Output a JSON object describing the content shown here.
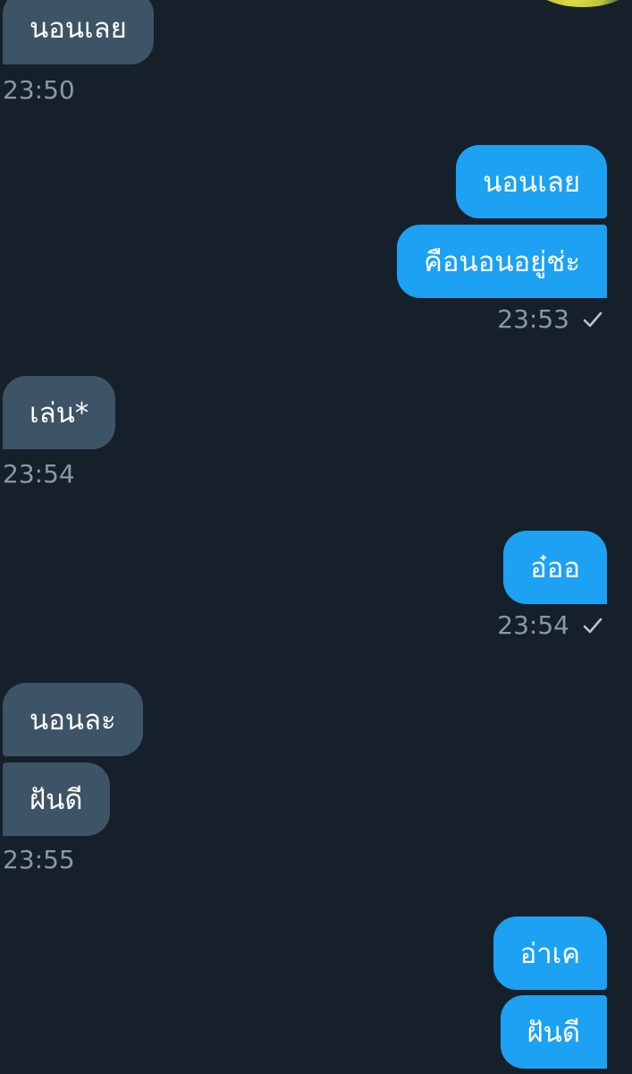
{
  "messages": [
    {
      "text": "นอนเลย",
      "dir": "in"
    },
    {
      "time": "23:50"
    },
    {
      "text": "นอนเลย",
      "dir": "out"
    },
    {
      "text": "คือนอนอยู่ช่ะ",
      "dir": "out"
    },
    {
      "time": "23:53"
    },
    {
      "text": "เล่น*",
      "dir": "in"
    },
    {
      "time": "23:54"
    },
    {
      "text": "อ๋ออ",
      "dir": "out"
    },
    {
      "time": "23:54"
    },
    {
      "text": "นอนละ",
      "dir": "in"
    },
    {
      "text": "ฝันดี",
      "dir": "in"
    },
    {
      "time": "23:55"
    },
    {
      "text": "อ่าเค",
      "dir": "out"
    },
    {
      "text": "ฝันดี",
      "dir": "out"
    }
  ],
  "colors": {
    "background": "#16202a",
    "incoming_bubble": "#3d5466",
    "outgoing_bubble": "#1da1f2",
    "timestamp": "#8899a6"
  },
  "icons": {
    "sent_status": "check-icon",
    "avatar": "avatar"
  }
}
